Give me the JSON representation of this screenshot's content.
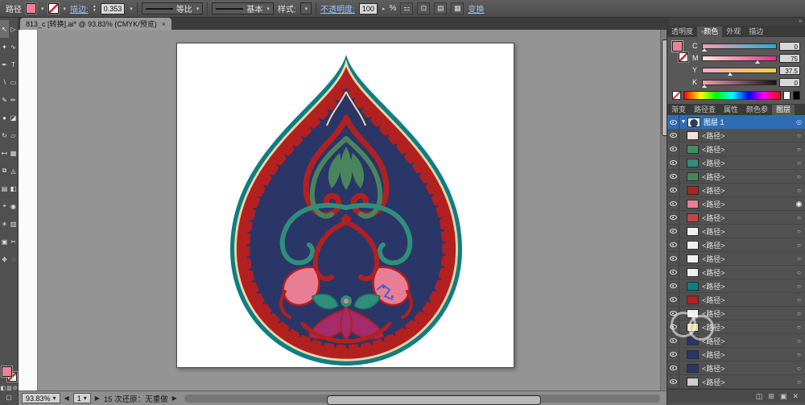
{
  "colors": {
    "fill_pink": "#ef7f95",
    "selection_blue": "#2e6db4",
    "link_blue": "#9fc3f5",
    "ornament_teal": "#0e7e85",
    "ornament_red": "#b32020",
    "ornament_navy": "#2a3668",
    "ornament_magenta": "#a62a6e"
  },
  "control_bar": {
    "mode_label": "路径",
    "stroke_link": "描边:",
    "stroke_value": "0.353",
    "profile_value": "等比",
    "brush_value": "基本",
    "style_label": "样式:",
    "opacity_link": "不透明度:",
    "opacity_value": "100",
    "percent": "%",
    "transform_link": "变换"
  },
  "doc_tab": {
    "title": "813_c [转换].ai* @ 93.83% (CMYK/预览)",
    "close": "×"
  },
  "toolbar": {
    "tools": [
      {
        "name": "selection-tool",
        "glyph": "↖",
        "mod": "active"
      },
      {
        "name": "direct-selection-tool",
        "glyph": "▷"
      },
      {
        "name": "magic-wand-tool",
        "glyph": "✦"
      },
      {
        "name": "lasso-tool",
        "glyph": "∿"
      },
      {
        "name": "pen-tool",
        "glyph": "✒"
      },
      {
        "name": "type-tool",
        "glyph": "T"
      },
      {
        "name": "line-segment-tool",
        "glyph": "∖"
      },
      {
        "name": "rectangle-tool",
        "glyph": "▭"
      },
      {
        "name": "paintbrush-tool",
        "glyph": "✎"
      },
      {
        "name": "pencil-tool",
        "glyph": "✏"
      },
      {
        "name": "blob-brush-tool",
        "glyph": "●"
      },
      {
        "name": "eraser-tool",
        "glyph": "◪"
      },
      {
        "name": "rotate-tool",
        "glyph": "↻"
      },
      {
        "name": "scale-tool",
        "glyph": "▱"
      },
      {
        "name": "width-tool",
        "glyph": "⊷"
      },
      {
        "name": "free-transform-tool",
        "glyph": "▦"
      },
      {
        "name": "shape-builder-tool",
        "glyph": "⧉"
      },
      {
        "name": "perspective-grid-tool",
        "glyph": "◬"
      },
      {
        "name": "mesh-tool",
        "glyph": "▤"
      },
      {
        "name": "gradient-tool",
        "glyph": "◧"
      },
      {
        "name": "eyedropper-tool",
        "glyph": "⌖"
      },
      {
        "name": "blend-tool",
        "glyph": "◉"
      },
      {
        "name": "symbol-sprayer-tool",
        "glyph": "✳"
      },
      {
        "name": "column-graph-tool",
        "glyph": "▥"
      },
      {
        "name": "artboard-tool",
        "glyph": "▣"
      },
      {
        "name": "slice-tool",
        "glyph": "✂"
      },
      {
        "name": "hand-tool",
        "glyph": "✥"
      },
      {
        "name": "zoom-tool",
        "glyph": "◌"
      }
    ]
  },
  "right_panel": {
    "top_tabs": [
      {
        "label": "透明度"
      },
      {
        "label": "◦颜色",
        "mod": "active"
      },
      {
        "label": "外观"
      },
      {
        "label": "描边"
      }
    ],
    "color": {
      "sliders": [
        {
          "label": "C",
          "value": "0",
          "pct": "2%",
          "grad": "linear-gradient(90deg,#f69db2,#1fb0d6)"
        },
        {
          "label": "M",
          "value": "75",
          "pct": "75%",
          "grad": "linear-gradient(90deg,#f6e7d6,#e62f82)"
        },
        {
          "label": "Y",
          "value": "37.5",
          "pct": "37.5%",
          "grad": "linear-gradient(90deg,#f3a8c4,#efd23e)"
        },
        {
          "label": "K",
          "value": "0",
          "pct": "2%",
          "grad": "linear-gradient(90deg,#f69db2,#141414)"
        }
      ]
    },
    "mid_tabs": [
      {
        "label": "渐变"
      },
      {
        "label": "路径查"
      },
      {
        "label": "属性"
      },
      {
        "label": "颜色参"
      },
      {
        "label": "图层",
        "mod": "active"
      }
    ],
    "layers": {
      "name": "图层 1",
      "items": [
        {
          "label": "<路径>",
          "thumb": "#f2dfe2",
          "target": "○"
        },
        {
          "label": "<路径>",
          "thumb": "#3f8f5f",
          "target": "○"
        },
        {
          "label": "<路径>",
          "thumb": "#2f8f7a",
          "target": "○"
        },
        {
          "label": "<路径>",
          "thumb": "#49855c",
          "target": "○"
        },
        {
          "label": "<路径>",
          "thumb": "#b32020",
          "target": "○"
        },
        {
          "label": "<路径>",
          "thumb": "#e87e93",
          "target": "◉",
          "mod": "sel"
        },
        {
          "label": "<路径>",
          "thumb": "#c54545",
          "target": "○"
        },
        {
          "label": "<路径>",
          "thumb": "#f0f0f0",
          "target": "○"
        },
        {
          "label": "<路径>",
          "thumb": "#f0f0f0",
          "target": "○"
        },
        {
          "label": "<路径>",
          "thumb": "#f0f0f0",
          "target": "○"
        },
        {
          "label": "<路径>",
          "thumb": "#f0f0f0",
          "target": "○"
        },
        {
          "label": "<路径>",
          "thumb": "#0e7e85",
          "target": "○"
        },
        {
          "label": "<路径>",
          "thumb": "#b32020",
          "target": "○"
        },
        {
          "label": "<路径>",
          "thumb": "#f0f0f0",
          "target": "○"
        },
        {
          "label": "<路径>",
          "thumb": "#e7d9ab",
          "target": "○"
        },
        {
          "label": "<路径>",
          "thumb": "#2a3668",
          "target": "○"
        },
        {
          "label": "<路径>",
          "thumb": "#2a3668",
          "target": "○"
        },
        {
          "label": "<路径>",
          "thumb": "#2a3668",
          "target": "○"
        },
        {
          "label": "<路径>",
          "thumb": "#cfcfcf",
          "target": "○"
        }
      ]
    }
  },
  "status_bar": {
    "zoom": "93.83%",
    "artboard": "1",
    "undo": "15 次还原：无重做"
  }
}
